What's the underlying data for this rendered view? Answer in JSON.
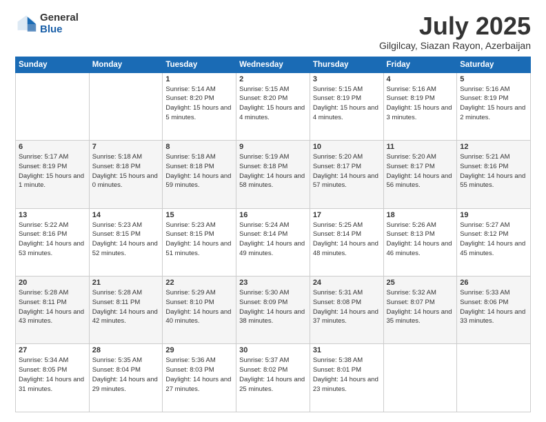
{
  "logo": {
    "general": "General",
    "blue": "Blue"
  },
  "header": {
    "title": "July 2025",
    "subtitle": "Gilgilcay, Siazan Rayon, Azerbaijan"
  },
  "weekdays": [
    "Sunday",
    "Monday",
    "Tuesday",
    "Wednesday",
    "Thursday",
    "Friday",
    "Saturday"
  ],
  "weeks": [
    [
      {
        "day": "",
        "info": ""
      },
      {
        "day": "",
        "info": ""
      },
      {
        "day": "1",
        "info": "Sunrise: 5:14 AM\nSunset: 8:20 PM\nDaylight: 15 hours and 5 minutes."
      },
      {
        "day": "2",
        "info": "Sunrise: 5:15 AM\nSunset: 8:20 PM\nDaylight: 15 hours and 4 minutes."
      },
      {
        "day": "3",
        "info": "Sunrise: 5:15 AM\nSunset: 8:19 PM\nDaylight: 15 hours and 4 minutes."
      },
      {
        "day": "4",
        "info": "Sunrise: 5:16 AM\nSunset: 8:19 PM\nDaylight: 15 hours and 3 minutes."
      },
      {
        "day": "5",
        "info": "Sunrise: 5:16 AM\nSunset: 8:19 PM\nDaylight: 15 hours and 2 minutes."
      }
    ],
    [
      {
        "day": "6",
        "info": "Sunrise: 5:17 AM\nSunset: 8:19 PM\nDaylight: 15 hours and 1 minute."
      },
      {
        "day": "7",
        "info": "Sunrise: 5:18 AM\nSunset: 8:18 PM\nDaylight: 15 hours and 0 minutes."
      },
      {
        "day": "8",
        "info": "Sunrise: 5:18 AM\nSunset: 8:18 PM\nDaylight: 14 hours and 59 minutes."
      },
      {
        "day": "9",
        "info": "Sunrise: 5:19 AM\nSunset: 8:18 PM\nDaylight: 14 hours and 58 minutes."
      },
      {
        "day": "10",
        "info": "Sunrise: 5:20 AM\nSunset: 8:17 PM\nDaylight: 14 hours and 57 minutes."
      },
      {
        "day": "11",
        "info": "Sunrise: 5:20 AM\nSunset: 8:17 PM\nDaylight: 14 hours and 56 minutes."
      },
      {
        "day": "12",
        "info": "Sunrise: 5:21 AM\nSunset: 8:16 PM\nDaylight: 14 hours and 55 minutes."
      }
    ],
    [
      {
        "day": "13",
        "info": "Sunrise: 5:22 AM\nSunset: 8:16 PM\nDaylight: 14 hours and 53 minutes."
      },
      {
        "day": "14",
        "info": "Sunrise: 5:23 AM\nSunset: 8:15 PM\nDaylight: 14 hours and 52 minutes."
      },
      {
        "day": "15",
        "info": "Sunrise: 5:23 AM\nSunset: 8:15 PM\nDaylight: 14 hours and 51 minutes."
      },
      {
        "day": "16",
        "info": "Sunrise: 5:24 AM\nSunset: 8:14 PM\nDaylight: 14 hours and 49 minutes."
      },
      {
        "day": "17",
        "info": "Sunrise: 5:25 AM\nSunset: 8:14 PM\nDaylight: 14 hours and 48 minutes."
      },
      {
        "day": "18",
        "info": "Sunrise: 5:26 AM\nSunset: 8:13 PM\nDaylight: 14 hours and 46 minutes."
      },
      {
        "day": "19",
        "info": "Sunrise: 5:27 AM\nSunset: 8:12 PM\nDaylight: 14 hours and 45 minutes."
      }
    ],
    [
      {
        "day": "20",
        "info": "Sunrise: 5:28 AM\nSunset: 8:11 PM\nDaylight: 14 hours and 43 minutes."
      },
      {
        "day": "21",
        "info": "Sunrise: 5:28 AM\nSunset: 8:11 PM\nDaylight: 14 hours and 42 minutes."
      },
      {
        "day": "22",
        "info": "Sunrise: 5:29 AM\nSunset: 8:10 PM\nDaylight: 14 hours and 40 minutes."
      },
      {
        "day": "23",
        "info": "Sunrise: 5:30 AM\nSunset: 8:09 PM\nDaylight: 14 hours and 38 minutes."
      },
      {
        "day": "24",
        "info": "Sunrise: 5:31 AM\nSunset: 8:08 PM\nDaylight: 14 hours and 37 minutes."
      },
      {
        "day": "25",
        "info": "Sunrise: 5:32 AM\nSunset: 8:07 PM\nDaylight: 14 hours and 35 minutes."
      },
      {
        "day": "26",
        "info": "Sunrise: 5:33 AM\nSunset: 8:06 PM\nDaylight: 14 hours and 33 minutes."
      }
    ],
    [
      {
        "day": "27",
        "info": "Sunrise: 5:34 AM\nSunset: 8:05 PM\nDaylight: 14 hours and 31 minutes."
      },
      {
        "day": "28",
        "info": "Sunrise: 5:35 AM\nSunset: 8:04 PM\nDaylight: 14 hours and 29 minutes."
      },
      {
        "day": "29",
        "info": "Sunrise: 5:36 AM\nSunset: 8:03 PM\nDaylight: 14 hours and 27 minutes."
      },
      {
        "day": "30",
        "info": "Sunrise: 5:37 AM\nSunset: 8:02 PM\nDaylight: 14 hours and 25 minutes."
      },
      {
        "day": "31",
        "info": "Sunrise: 5:38 AM\nSunset: 8:01 PM\nDaylight: 14 hours and 23 minutes."
      },
      {
        "day": "",
        "info": ""
      },
      {
        "day": "",
        "info": ""
      }
    ]
  ]
}
